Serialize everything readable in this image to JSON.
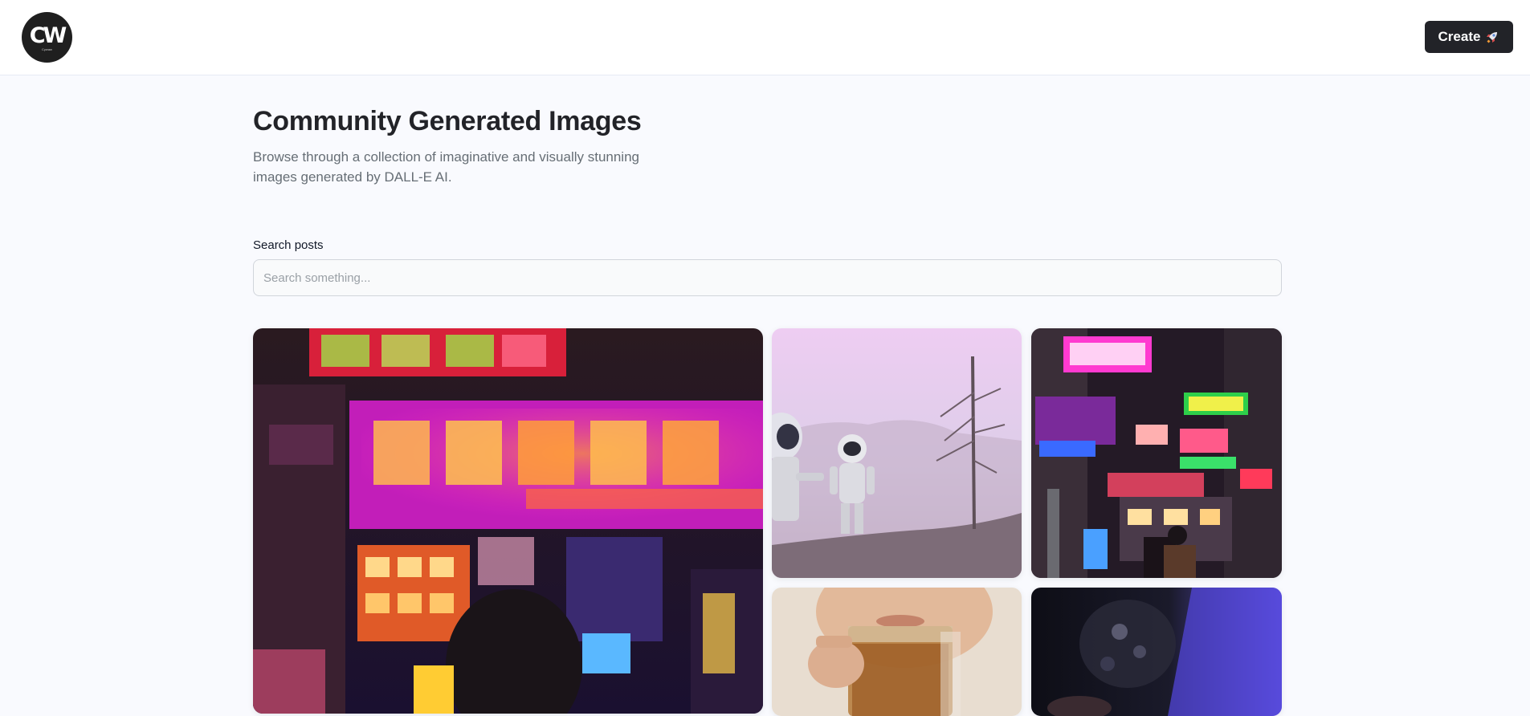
{
  "header": {
    "logo_text": "CW",
    "logo_subtext": "Cywaw",
    "create_label": "Create"
  },
  "main": {
    "title": "Community Generated Images",
    "subtitle": "Browse through a collection of imaginative and visually stunning images generated by DALL-E AI.",
    "search": {
      "label": "Search posts",
      "placeholder": "Search something...",
      "value": ""
    }
  },
  "gallery": [
    {
      "subject": "neon signs city street at night"
    },
    {
      "subject": "astronauts in misty pink landscape"
    },
    {
      "subject": "neon lit city street"
    },
    {
      "subject": "person drinking from glass mug"
    },
    {
      "subject": "dark blue abstract"
    }
  ],
  "colors": {
    "accent": "#222328",
    "background": "#f9fafe",
    "header_bg": "#ffffff"
  }
}
